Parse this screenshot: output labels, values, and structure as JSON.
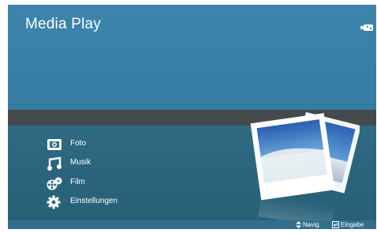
{
  "header": {
    "title": "Media Play",
    "device_icon": "usb-icon"
  },
  "menu": {
    "items": [
      {
        "label": "Foto",
        "icon": "photo-icon"
      },
      {
        "label": "Musik",
        "icon": "music-icon"
      },
      {
        "label": "Film",
        "icon": "film-icon"
      },
      {
        "label": "Einstellungen",
        "icon": "settings-icon"
      }
    ]
  },
  "status_bar": {
    "navigate_label": "Navig.",
    "navigate_icon": "up-down-arrows-icon",
    "enter_label": "Eingabe",
    "enter_icon": "enter-key-icon"
  },
  "colors": {
    "top_panel": "#3a7fa6",
    "divider": "#454a4d",
    "menu_panel": "#2f6a83",
    "text": "#ffffff"
  }
}
